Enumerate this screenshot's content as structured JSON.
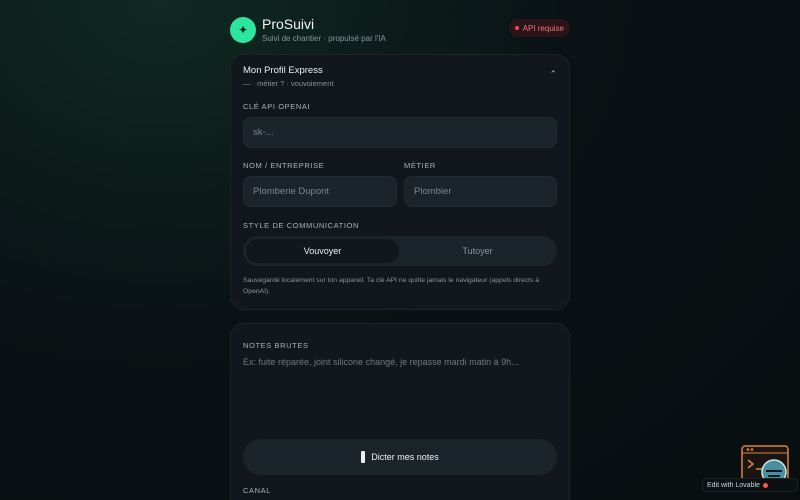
{
  "header": {
    "logo_glyph": "✦",
    "title": "ProSuivi",
    "subtitle": "Suivi de chantier · propulsé par l'IA",
    "api_badge": "API requise"
  },
  "profile": {
    "title": "Mon Profil Express",
    "subtitle": "— · métier ? · vouvoiement",
    "api_key_label": "CLÉ API OPENAI",
    "api_key_placeholder": "sk-...",
    "name_label": "NOM / ENTREPRISE",
    "name_placeholder": "Plomberie Dupont",
    "job_label": "MÉTIER",
    "job_placeholder": "Plombier",
    "style_label": "STYLE DE COMMUNICATION",
    "style_options": [
      "Vouvoyer",
      "Tutoyer"
    ],
    "style_selected": "Vouvoyer",
    "note": "Sauvegardé localement sur ton appareil. Ta clé API ne quitte jamais le navigateur (appels directs à OpenAI)."
  },
  "notes": {
    "label": "NOTES BRUTES",
    "placeholder": "Ex: fuite réparée, joint silicone changé, je repasse mardi matin à 9h...",
    "dictate_label": "Dicter mes notes",
    "channel_label": "CANAL"
  },
  "lovable_badge": "Edit with Lovable",
  "colors": {
    "accent": "#2ee59d",
    "danger": "#ef4a52",
    "background": "#0a1215",
    "card": "#11171c"
  }
}
